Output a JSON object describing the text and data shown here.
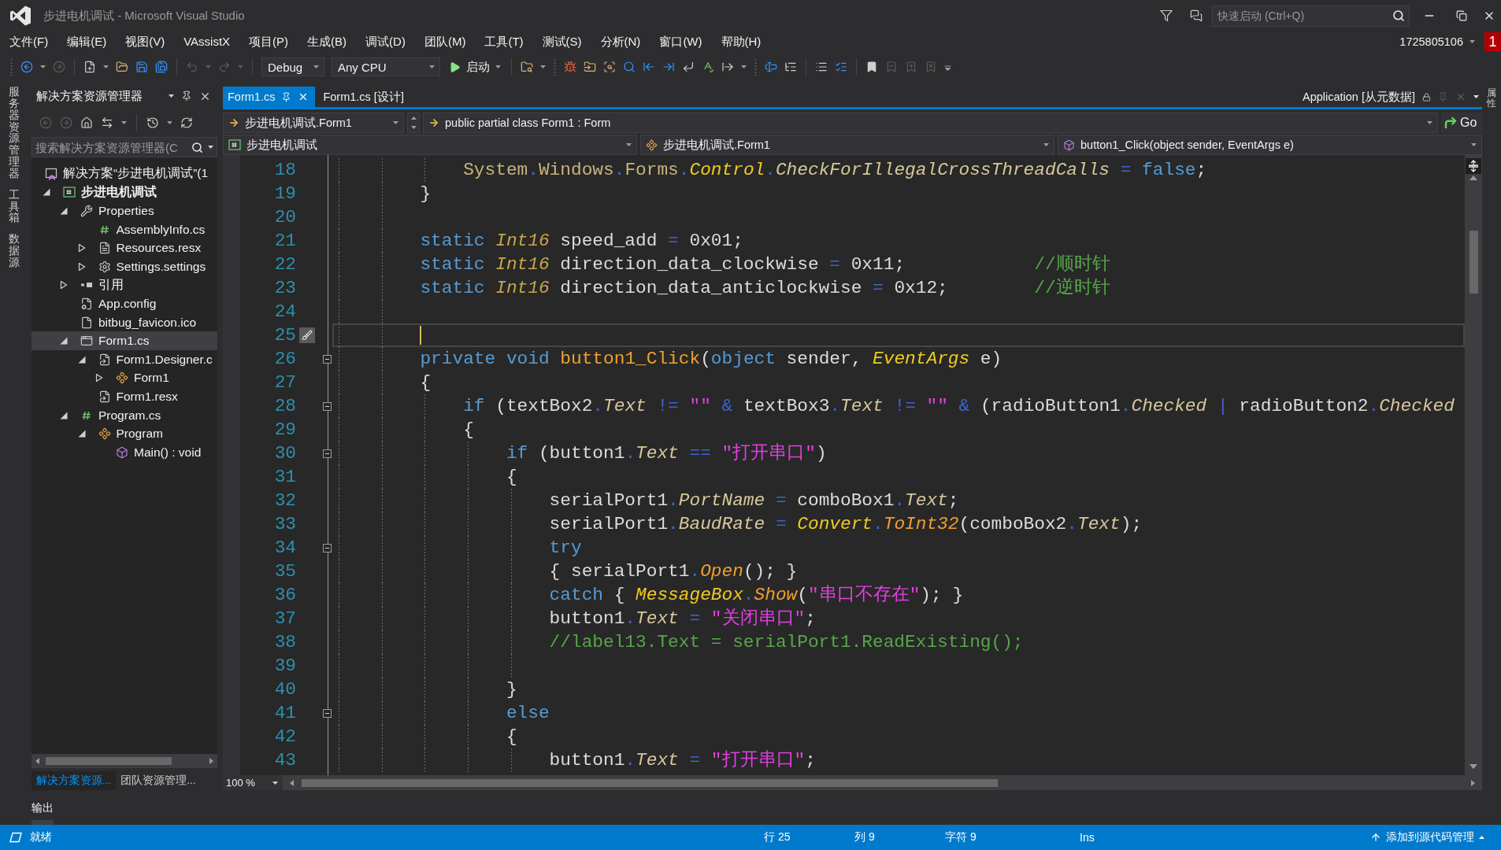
{
  "window": {
    "title": "步进电机调试 - Microsoft Visual Studio",
    "quick_launch": {
      "placeholder": "快速启动 (Ctrl+Q)"
    }
  },
  "menu": {
    "items": [
      "文件(F)",
      "编辑(E)",
      "视图(V)",
      "VAssistX",
      "项目(P)",
      "生成(B)",
      "调试(D)",
      "团队(M)",
      "工具(T)",
      "测试(S)",
      "分析(N)",
      "窗口(W)",
      "帮助(H)"
    ],
    "account": "1725805106",
    "notification_count": "1"
  },
  "toolbar": {
    "buttons": [
      {
        "disabled": false
      },
      {
        "disabled": true
      },
      {
        "disabled": false
      },
      {
        "disabled": false
      },
      {
        "disabled": false
      },
      {
        "disabled": false
      },
      {
        "disabled": true
      },
      {
        "disabled": true
      },
      {
        "disabled": false
      },
      {
        "disabled": false
      },
      {
        "disabled": false
      },
      {
        "disabled": false
      },
      {
        "disabled": false
      },
      {
        "disabled": false
      },
      {
        "disabled": false
      },
      {
        "disabled": false
      },
      {
        "disabled": false
      },
      {
        "disabled": false
      },
      {
        "disabled": false
      },
      {
        "disabled": false
      },
      {
        "disabled": false
      },
      {
        "disabled": false
      },
      {
        "disabled": false
      },
      {
        "disabled": true
      },
      {
        "disabled": true
      },
      {
        "disabled": true
      }
    ],
    "configuration": "Debug",
    "platform": "Any CPU",
    "start": "启动"
  },
  "left_side_tabs": [
    "服务器资源管理器",
    "工具箱",
    "数据源"
  ],
  "solution_explorer": {
    "title": "解决方案资源管理器",
    "toolbar_buttons": [
      {
        "disabled": true
      },
      {
        "disabled": true
      },
      {
        "disabled": false
      },
      {
        "disabled": false
      },
      {
        "disabled": false
      },
      {
        "disabled": false
      }
    ],
    "search": {
      "placeholder": "搜索解决方案资源管理器(C"
    },
    "tree": [
      {
        "kind": "solution",
        "label": "解决方案“步进电机调试”(1",
        "selected": false,
        "children": [
          {
            "kind": "project",
            "label": "步进电机调试",
            "expanded": true,
            "selected": false,
            "children": [
              {
                "kind": "properties",
                "label": "Properties",
                "expanded": true,
                "selected": false,
                "children": [
                  {
                    "kind": "csharp",
                    "label": "AssemblyInfo.cs",
                    "selected": false
                  },
                  {
                    "kind": "resx",
                    "label": "Resources.resx",
                    "expanded": false,
                    "selected": false
                  },
                  {
                    "kind": "settings",
                    "label": "Settings.settings",
                    "expanded": false,
                    "selected": false
                  }
                ]
              },
              {
                "kind": "references",
                "label": "引用",
                "expanded": false,
                "selected": false
              },
              {
                "kind": "config",
                "label": "App.config",
                "selected": false
              },
              {
                "kind": "file",
                "label": "bitbug_favicon.ico",
                "selected": false
              },
              {
                "kind": "form",
                "label": "Form1.cs",
                "expanded": true,
                "selected": true,
                "children": [
                  {
                    "kind": "dependent",
                    "label": "Form1.Designer.c",
                    "expanded": true,
                    "selected": false,
                    "children": [
                      {
                        "kind": "class",
                        "label": "Form1",
                        "expanded": false,
                        "selected": false
                      }
                    ]
                  },
                  {
                    "kind": "dependent",
                    "label": "Form1.resx",
                    "selected": false
                  }
                ]
              },
              {
                "kind": "csharp",
                "label": "Program.cs",
                "expanded": true,
                "selected": false,
                "children": [
                  {
                    "kind": "class",
                    "label": "Program",
                    "expanded": true,
                    "selected": false,
                    "children": [
                      {
                        "kind": "method",
                        "label": "Main() : void",
                        "selected": false
                      }
                    ]
                  }
                ]
              }
            ]
          }
        ]
      }
    ],
    "tabs": [
      {
        "label": "解决方案资源...",
        "selected": true
      },
      {
        "label": "团队资源管理...",
        "selected": false
      }
    ]
  },
  "editor": {
    "tabs": [
      {
        "label": "Form1.cs",
        "selected": true
      },
      {
        "label": "Form1.cs [设计]",
        "selected": false
      }
    ],
    "preview_tab": "Application [从元数据]",
    "navigation": {
      "scope": "步进电机调试.Form1",
      "type_declaration": "public partial class Form1 : Form",
      "go": "Go",
      "project": "步进电机调试",
      "type": "步进电机调试.Form1",
      "member": "button1_Click(object sender, EventArgs e)"
    },
    "lines": [
      {
        "children": [
          {
            "number": "18",
            "current": false,
            "collapsible": false,
            "tokens": [
              {
                "kind": "ns",
                "text": "System"
              },
              {
                "kind": "op",
                "text": "."
              },
              {
                "kind": "ns",
                "text": "Windows"
              },
              {
                "kind": "op",
                "text": "."
              },
              {
                "kind": "ns",
                "text": "Forms"
              },
              {
                "kind": "op",
                "text": "."
              },
              {
                "kind": "type",
                "text": "Control"
              },
              {
                "kind": "op",
                "text": "."
              },
              {
                "kind": "prop",
                "text": "CheckForIllegalCrossThreadCalls "
              },
              {
                "kind": "op",
                "text": "= "
              },
              {
                "kind": "kw",
                "text": "false"
              },
              {
                "kind": "plain",
                "text": ";"
              }
            ]
          }
        ]
      },
      {
        "number": "19",
        "current": false,
        "collapsible": false,
        "tokens": [
          {
            "kind": "plain",
            "text": "}"
          }
        ]
      },
      {
        "number": "20",
        "current": false,
        "collapsible": false
      },
      {
        "number": "21",
        "current": false,
        "collapsible": false,
        "tokens": [
          {
            "kind": "kw",
            "text": "static "
          },
          {
            "kind": "struct",
            "text": "Int16"
          },
          {
            "kind": "plain",
            "text": " speed_add "
          },
          {
            "kind": "op",
            "text": "="
          },
          {
            "kind": "plain",
            "text": " 0x01;"
          }
        ]
      },
      {
        "number": "22",
        "current": false,
        "collapsible": false,
        "tokens": [
          {
            "kind": "kw",
            "text": "static "
          },
          {
            "kind": "struct",
            "text": "Int16"
          },
          {
            "kind": "plain",
            "text": " direction_data_clockwise "
          },
          {
            "kind": "op",
            "text": "="
          },
          {
            "kind": "plain",
            "text": " 0x11;            "
          },
          {
            "kind": "cmt",
            "text": "//顺时针"
          }
        ]
      },
      {
        "number": "23",
        "current": false,
        "collapsible": false,
        "tokens": [
          {
            "kind": "kw",
            "text": "static "
          },
          {
            "kind": "struct",
            "text": "Int16"
          },
          {
            "kind": "plain",
            "text": " direction_data_anticlockwise "
          },
          {
            "kind": "op",
            "text": "="
          },
          {
            "kind": "plain",
            "text": " 0x12;        "
          },
          {
            "kind": "cmt",
            "text": "//逆时针"
          }
        ]
      },
      {
        "number": "24",
        "current": false,
        "collapsible": false
      },
      {
        "number": "25",
        "current": true,
        "collapsible": false
      },
      {
        "number": "26",
        "current": false,
        "collapsible": true,
        "tokens": [
          {
            "kind": "kw",
            "text": "private void "
          },
          {
            "kind": "decl",
            "text": "button1_Click"
          },
          {
            "kind": "plain",
            "text": "("
          },
          {
            "kind": "kw",
            "text": "object"
          },
          {
            "kind": "plain",
            "text": " sender, "
          },
          {
            "kind": "type",
            "text": "EventArgs"
          },
          {
            "kind": "plain",
            "text": " e)"
          }
        ]
      },
      {
        "number": "27",
        "current": false,
        "collapsible": false,
        "tokens": [
          {
            "kind": "plain",
            "text": "{"
          }
        ],
        "children": [
          {
            "number": "28",
            "current": false,
            "collapsible": true,
            "tokens": [
              {
                "kind": "kw",
                "text": "if"
              },
              {
                "kind": "plain",
                "text": " (textBox2"
              },
              {
                "kind": "op",
                "text": "."
              },
              {
                "kind": "prop",
                "text": "Text "
              },
              {
                "kind": "op",
                "text": "!= "
              },
              {
                "kind": "str",
                "text": "\"\""
              },
              {
                "kind": "op",
                "text": " & "
              },
              {
                "kind": "plain",
                "text": "textBox3"
              },
              {
                "kind": "op",
                "text": "."
              },
              {
                "kind": "prop",
                "text": "Text "
              },
              {
                "kind": "op",
                "text": "!= "
              },
              {
                "kind": "str",
                "text": "\"\""
              },
              {
                "kind": "op",
                "text": " & "
              },
              {
                "kind": "plain",
                "text": "(radioButton1"
              },
              {
                "kind": "op",
                "text": "."
              },
              {
                "kind": "prop",
                "text": "Checked "
              },
              {
                "kind": "op",
                "text": "| "
              },
              {
                "kind": "plain",
                "text": "radioButton2"
              },
              {
                "kind": "op",
                "text": "."
              },
              {
                "kind": "prop",
                "text": "Checked"
              }
            ]
          },
          {
            "number": "29",
            "current": false,
            "collapsible": false,
            "tokens": [
              {
                "kind": "plain",
                "text": "{"
              }
            ],
            "children": [
              {
                "number": "30",
                "current": false,
                "collapsible": true,
                "tokens": [
                  {
                    "kind": "kw",
                    "text": "if"
                  },
                  {
                    "kind": "plain",
                    "text": " (button1"
                  },
                  {
                    "kind": "op",
                    "text": "."
                  },
                  {
                    "kind": "prop",
                    "text": "Text "
                  },
                  {
                    "kind": "op",
                    "text": "== "
                  },
                  {
                    "kind": "str",
                    "text": "\"打开串口\""
                  },
                  {
                    "kind": "plain",
                    "text": ")"
                  }
                ]
              },
              {
                "number": "31",
                "current": false,
                "collapsible": false,
                "tokens": [
                  {
                    "kind": "plain",
                    "text": "{"
                  }
                ],
                "children": [
                  {
                    "number": "32",
                    "current": false,
                    "collapsible": false,
                    "tokens": [
                      {
                        "kind": "plain",
                        "text": "serialPort1"
                      },
                      {
                        "kind": "op",
                        "text": "."
                      },
                      {
                        "kind": "prop",
                        "text": "PortName "
                      },
                      {
                        "kind": "op",
                        "text": "= "
                      },
                      {
                        "kind": "plain",
                        "text": "comboBox1"
                      },
                      {
                        "kind": "op",
                        "text": "."
                      },
                      {
                        "kind": "prop",
                        "text": "Text"
                      },
                      {
                        "kind": "plain",
                        "text": ";"
                      }
                    ]
                  },
                  {
                    "number": "33",
                    "current": false,
                    "collapsible": false,
                    "tokens": [
                      {
                        "kind": "plain",
                        "text": "serialPort1"
                      },
                      {
                        "kind": "op",
                        "text": "."
                      },
                      {
                        "kind": "prop",
                        "text": "BaudRate "
                      },
                      {
                        "kind": "op",
                        "text": "= "
                      },
                      {
                        "kind": "type",
                        "text": "Convert"
                      },
                      {
                        "kind": "op",
                        "text": "."
                      },
                      {
                        "kind": "method",
                        "text": "ToInt32"
                      },
                      {
                        "kind": "plain",
                        "text": "(comboBox2"
                      },
                      {
                        "kind": "op",
                        "text": "."
                      },
                      {
                        "kind": "prop",
                        "text": "Text"
                      },
                      {
                        "kind": "plain",
                        "text": ");"
                      }
                    ]
                  },
                  {
                    "number": "34",
                    "current": false,
                    "collapsible": true,
                    "tokens": [
                      {
                        "kind": "kw",
                        "text": "try"
                      }
                    ]
                  },
                  {
                    "number": "35",
                    "current": false,
                    "collapsible": false,
                    "tokens": [
                      {
                        "kind": "plain",
                        "text": "{ serialPort1"
                      },
                      {
                        "kind": "op",
                        "text": "."
                      },
                      {
                        "kind": "method",
                        "text": "Open"
                      },
                      {
                        "kind": "plain",
                        "text": "(); }"
                      }
                    ]
                  },
                  {
                    "number": "36",
                    "current": false,
                    "collapsible": false,
                    "tokens": [
                      {
                        "kind": "kw",
                        "text": "catch"
                      },
                      {
                        "kind": "plain",
                        "text": " { "
                      },
                      {
                        "kind": "type",
                        "text": "MessageBox"
                      },
                      {
                        "kind": "op",
                        "text": "."
                      },
                      {
                        "kind": "method",
                        "text": "Show"
                      },
                      {
                        "kind": "plain",
                        "text": "("
                      },
                      {
                        "kind": "str",
                        "text": "\"串口不存在\""
                      },
                      {
                        "kind": "plain",
                        "text": "); }"
                      }
                    ]
                  },
                  {
                    "number": "37",
                    "current": false,
                    "collapsible": false,
                    "tokens": [
                      {
                        "kind": "plain",
                        "text": "button1"
                      },
                      {
                        "kind": "op",
                        "text": "."
                      },
                      {
                        "kind": "prop",
                        "text": "Text "
                      },
                      {
                        "kind": "op",
                        "text": "= "
                      },
                      {
                        "kind": "str",
                        "text": "\"关闭串口\""
                      },
                      {
                        "kind": "plain",
                        "text": ";"
                      }
                    ]
                  },
                  {
                    "number": "38",
                    "current": false,
                    "collapsible": false,
                    "tokens": [
                      {
                        "kind": "cmt",
                        "text": "//label13.Text = serialPort1.ReadExisting();"
                      }
                    ]
                  },
                  {
                    "number": "39",
                    "current": false,
                    "collapsible": false
                  }
                ]
              },
              {
                "number": "40",
                "current": false,
                "collapsible": false,
                "tokens": [
                  {
                    "kind": "plain",
                    "text": "}"
                  }
                ]
              },
              {
                "number": "41",
                "current": false,
                "collapsible": true,
                "tokens": [
                  {
                    "kind": "kw",
                    "text": "else"
                  }
                ]
              },
              {
                "number": "42",
                "current": false,
                "collapsible": false,
                "tokens": [
                  {
                    "kind": "plain",
                    "text": "{"
                  }
                ],
                "children": [
                  {
                    "number": "43",
                    "current": false,
                    "collapsible": false,
                    "tokens": [
                      {
                        "kind": "plain",
                        "text": "button1"
                      },
                      {
                        "kind": "op",
                        "text": "."
                      },
                      {
                        "kind": "prop",
                        "text": "Text "
                      },
                      {
                        "kind": "op",
                        "text": "= "
                      },
                      {
                        "kind": "str",
                        "text": "\"打开串口\""
                      },
                      {
                        "kind": "plain",
                        "text": ";"
                      }
                    ]
                  }
                ]
              }
            ]
          }
        ]
      }
    ],
    "zoom": "100 %"
  },
  "right_side_tabs": [
    "属性"
  ],
  "output_tab": "输出",
  "status_bar": {
    "state": "就绪",
    "line": "行 25",
    "column": "列 9",
    "character": "字符 9",
    "insert_mode": "Ins",
    "source_control": "添加到源代码管理"
  }
}
